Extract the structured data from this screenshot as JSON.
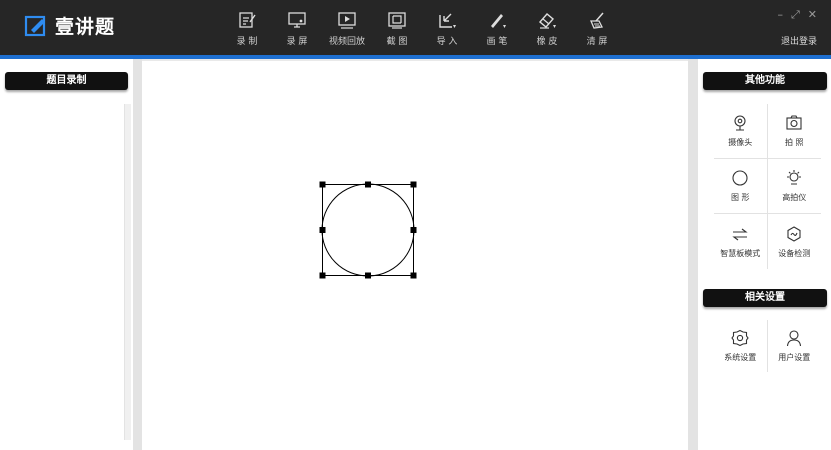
{
  "app": {
    "title": "壹讲题",
    "logout_label": "退出登录"
  },
  "window_controls": {
    "minimize": "–",
    "maximize": "⤢",
    "close": "✕"
  },
  "toolbar": [
    {
      "icon": "record-icon",
      "label": "录 制"
    },
    {
      "icon": "screen-record-icon",
      "label": "录 屏"
    },
    {
      "icon": "video-playback-icon",
      "label": "视频回放"
    },
    {
      "icon": "screenshot-icon",
      "label": "截 图"
    },
    {
      "icon": "import-icon",
      "label": "导 入"
    },
    {
      "icon": "pen-icon",
      "label": "画 笔"
    },
    {
      "icon": "eraser-icon",
      "label": "橡 皮"
    },
    {
      "icon": "clear-screen-icon",
      "label": "清 屏"
    }
  ],
  "left_panel": {
    "header": "题目录制"
  },
  "right_panel": {
    "other_header": "其他功能",
    "other_items": [
      {
        "icon": "camera-icon",
        "label": "摄像头"
      },
      {
        "icon": "photo-icon",
        "label": "拍 照"
      },
      {
        "icon": "shape-icon",
        "label": "图 形"
      },
      {
        "icon": "document-camera-icon",
        "label": "高拍仪"
      },
      {
        "icon": "smart-board-icon",
        "label": "智慧板模式"
      },
      {
        "icon": "device-check-icon",
        "label": "设备检测"
      }
    ],
    "settings_header": "相关设置",
    "settings_items": [
      {
        "icon": "settings-gear-icon",
        "label": "系统设置"
      },
      {
        "icon": "user-icon",
        "label": "用户设置"
      }
    ]
  },
  "colors": {
    "topbar": "#262626",
    "accent": "#1e6fd0",
    "logo": "#2f8cf0"
  }
}
